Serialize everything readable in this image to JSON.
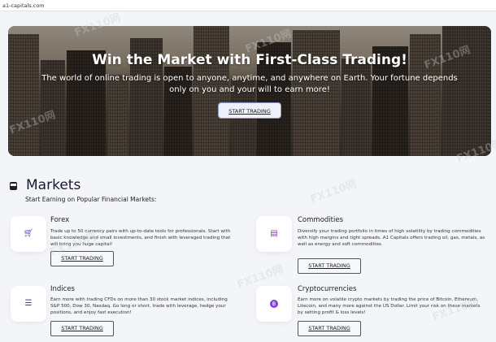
{
  "browser": {
    "url": "a1-capitals.com"
  },
  "hero": {
    "title": "Win the Market with First-Class Trading!",
    "text": "The world of online trading is open to anyone, anytime, and anywhere on Earth. Your fortune depends only on you and your will to earn more!",
    "button": "START TRADING"
  },
  "markets": {
    "title": "Markets",
    "subtitle": "Start Earning on Popular Financial Markets:",
    "cards": [
      {
        "title": "Forex",
        "icon": "shopping-cart-icon",
        "icon_color": "#5b5fd6",
        "desc": "Trade up to 50 currency pairs with up-to-date tools for professionals. Start with basic knowledge and small investments, and finish with leveraged trading that will bring you huge capital!",
        "button": "START TRADING"
      },
      {
        "title": "Commodities",
        "icon": "box-icon",
        "icon_color": "#8a3fa8",
        "desc": "Diversify your trading portfolio in times of high volatility by trading commodities with high margins and tight spreads. A1 Capitals offers trading oil, gas, metals, as well as energy and soft commodities.",
        "button": "START TRADING"
      },
      {
        "title": "Indices",
        "icon": "list-icon",
        "icon_color": "#3d3f8f",
        "desc": "Earn more with trading CFDs on more than 30 stock market indices, including S&P 500, Dow 30, Nasdaq. Go long or short, trade with leverage, hedge your positions, and enjoy fast execution!",
        "button": "START TRADING"
      },
      {
        "title": "Cryptocurrencies",
        "icon": "bitcoin-icon",
        "icon_color": "#7b3fd6",
        "desc": "Earn more on volatile crypto markets by trading the price of Bitcoin, Ethereum, Litecoin, and many more against the US Dollar. Limit your risk on these markets by setting profit & loss levels!",
        "button": "START TRADING"
      }
    ]
  },
  "watermark": "FX110网"
}
